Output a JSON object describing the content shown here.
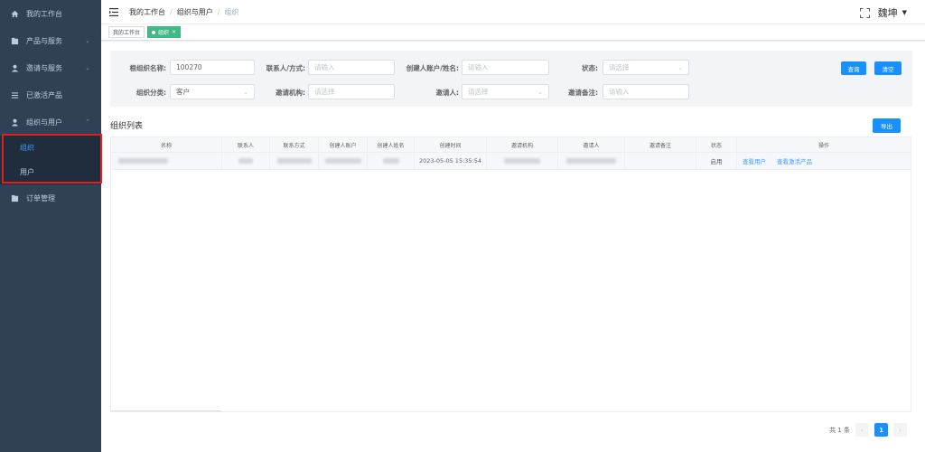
{
  "sidebar": {
    "items": [
      {
        "label": "我的工作台",
        "icon": "home-icon"
      },
      {
        "label": "产品与服务",
        "icon": "folder-icon"
      },
      {
        "label": "邀请与服务",
        "icon": "user-icon"
      },
      {
        "label": "已激活产品",
        "icon": "list-icon"
      },
      {
        "label": "组织与用户",
        "icon": "user-icon"
      }
    ],
    "sub_items": [
      {
        "label": "组织",
        "active": true
      },
      {
        "label": "用户",
        "active": false
      }
    ],
    "bottom_item": {
      "label": "订单管理",
      "icon": "folder-icon"
    }
  },
  "topbar": {
    "breadcrumb": [
      "我的工作台",
      "组织与用户",
      "组织"
    ],
    "username": "魏坤"
  },
  "tags": [
    {
      "label": "我的工作台",
      "active": false
    },
    {
      "label": "组织",
      "active": true
    }
  ],
  "filter": {
    "root_org_label": "根组织名称:",
    "root_org_value": "100270",
    "contact_label": "联系人/方式:",
    "contact_placeholder": "请输入",
    "creator_label": "创建人账户/姓名:",
    "creator_placeholder": "请输入",
    "status_label": "状态:",
    "status_placeholder": "请选择",
    "category_label": "组织分类:",
    "category_value": "客户",
    "invite_org_label": "邀请机构:",
    "invite_org_placeholder": "请选择",
    "inviter_label": "邀请人:",
    "inviter_placeholder": "请选择",
    "invite_note_label": "邀请备注:",
    "invite_note_placeholder": "请输入",
    "query_button": "查询",
    "clear_button": "清空"
  },
  "list": {
    "title": "组织列表",
    "export_button": "导出",
    "columns": [
      "名称",
      "联系人",
      "联系方式",
      "创建人账户",
      "创建人姓名",
      "创建时间",
      "邀请机构",
      "邀请人",
      "邀请备注",
      "状态",
      "操作"
    ],
    "rows": [
      {
        "created_time": "2023-05-05 15:35:54",
        "status": "启用",
        "action_users": "查看用户",
        "action_products": "查看激活产品"
      }
    ]
  },
  "pagination": {
    "total_text": "共 1 条",
    "current_page": "1",
    "prev": "‹",
    "next": "›"
  }
}
